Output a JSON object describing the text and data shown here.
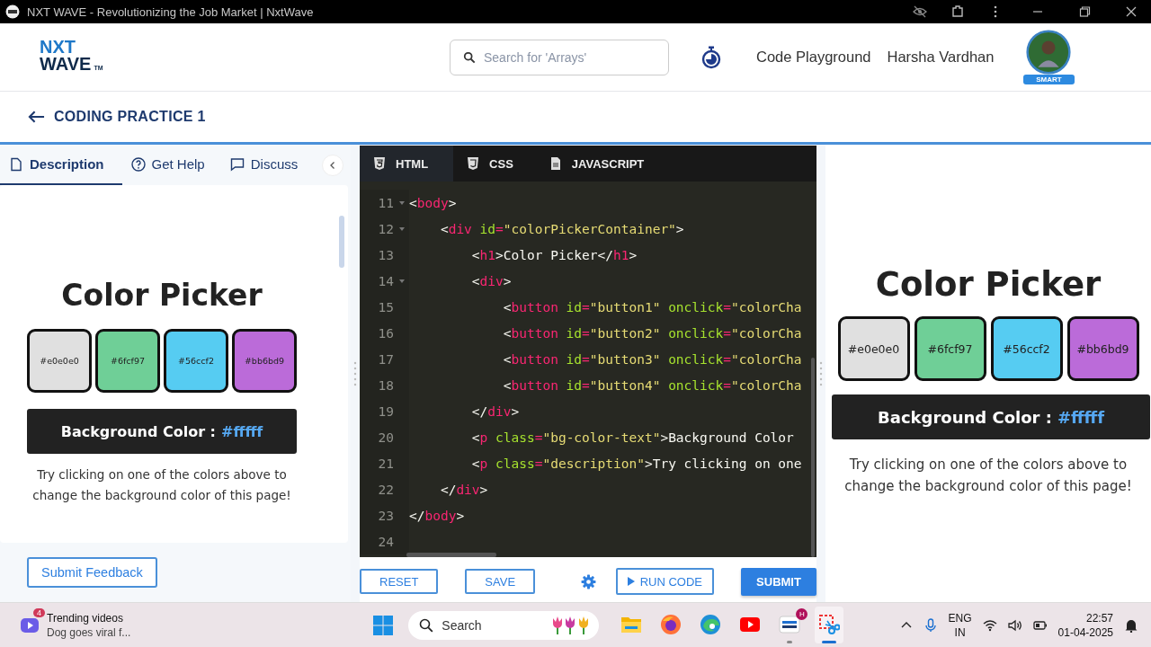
{
  "browser": {
    "title": "NXT WAVE - Revolutionizing the Job Market | NxtWave"
  },
  "header": {
    "logo": {
      "line1": "NXT",
      "line2": "WAVE",
      "mark": "TM"
    },
    "search": {
      "placeholder": "Search for 'Arrays'"
    },
    "link": "Code Playground",
    "user": {
      "name": "Harsha Vardhan",
      "badge": "SMART"
    }
  },
  "practice": {
    "title": "CODING PRACTICE 1"
  },
  "left_tabs": [
    {
      "label": "Description",
      "kind": "file",
      "selected": true
    },
    {
      "label": "Get Help",
      "kind": "help",
      "selected": false
    },
    {
      "label": "Discuss",
      "kind": "chat",
      "selected": false
    }
  ],
  "description_preview": {
    "heading": "Color Picker",
    "swatches": [
      {
        "label": "#e0e0e0",
        "color": "#e0e0e0"
      },
      {
        "label": "#6fcf97",
        "color": "#6fcf97"
      },
      {
        "label": "#56ccf2",
        "color": "#56ccf2"
      },
      {
        "label": "#bb6bd9",
        "color": "#bb6bd9"
      }
    ],
    "bg_label": "Background Color :",
    "bg_value": "#fffff",
    "text": "Try clicking on one of the colors above to change the background color of this page!"
  },
  "feedback_button": "Submit Feedback",
  "editor": {
    "tabs": [
      {
        "label": "HTML",
        "kind": "html",
        "selected": true
      },
      {
        "label": "CSS",
        "kind": "css",
        "selected": false
      },
      {
        "label": "JAVASCRIPT",
        "kind": "js",
        "selected": false
      }
    ],
    "lines": [
      {
        "number": "11",
        "foldable": true,
        "tokens": [
          {
            "kind": "p",
            "text": "<"
          },
          {
            "kind": "tag",
            "text": "body"
          },
          {
            "kind": "p",
            "text": ">"
          }
        ]
      },
      {
        "number": "12",
        "foldable": true,
        "tokens": [
          {
            "kind": "p",
            "text": "    <"
          },
          {
            "kind": "tag",
            "text": "div"
          },
          {
            "kind": "attr",
            "text": " id"
          },
          {
            "kind": "op",
            "text": "="
          },
          {
            "kind": "str",
            "text": "\"colorPickerContainer\""
          },
          {
            "kind": "p",
            "text": ">"
          }
        ]
      },
      {
        "number": "13",
        "foldable": false,
        "tokens": [
          {
            "kind": "p",
            "text": "        <"
          },
          {
            "kind": "tag",
            "text": "h1"
          },
          {
            "kind": "p",
            "text": ">"
          },
          {
            "kind": "txt",
            "text": "Color Picker"
          },
          {
            "kind": "p",
            "text": "</"
          },
          {
            "kind": "tag",
            "text": "h1"
          },
          {
            "kind": "p",
            "text": ">"
          }
        ]
      },
      {
        "number": "14",
        "foldable": true,
        "tokens": [
          {
            "kind": "p",
            "text": "        <"
          },
          {
            "kind": "tag",
            "text": "div"
          },
          {
            "kind": "p",
            "text": ">"
          }
        ]
      },
      {
        "number": "15",
        "foldable": false,
        "tokens": [
          {
            "kind": "p",
            "text": "            <"
          },
          {
            "kind": "tag",
            "text": "button"
          },
          {
            "kind": "attr",
            "text": " id"
          },
          {
            "kind": "op",
            "text": "="
          },
          {
            "kind": "str",
            "text": "\"button1\""
          },
          {
            "kind": "attr",
            "text": " onclick"
          },
          {
            "kind": "op",
            "text": "="
          },
          {
            "kind": "str",
            "text": "\"colorCha"
          }
        ]
      },
      {
        "number": "16",
        "foldable": false,
        "tokens": [
          {
            "kind": "p",
            "text": "            <"
          },
          {
            "kind": "tag",
            "text": "button"
          },
          {
            "kind": "attr",
            "text": " id"
          },
          {
            "kind": "op",
            "text": "="
          },
          {
            "kind": "str",
            "text": "\"button2\""
          },
          {
            "kind": "attr",
            "text": " onclick"
          },
          {
            "kind": "op",
            "text": "="
          },
          {
            "kind": "str",
            "text": "\"colorCha"
          }
        ]
      },
      {
        "number": "17",
        "foldable": false,
        "tokens": [
          {
            "kind": "p",
            "text": "            <"
          },
          {
            "kind": "tag",
            "text": "button"
          },
          {
            "kind": "attr",
            "text": " id"
          },
          {
            "kind": "op",
            "text": "="
          },
          {
            "kind": "str",
            "text": "\"button3\""
          },
          {
            "kind": "attr",
            "text": " onclick"
          },
          {
            "kind": "op",
            "text": "="
          },
          {
            "kind": "str",
            "text": "\"colorCha"
          }
        ]
      },
      {
        "number": "18",
        "foldable": false,
        "tokens": [
          {
            "kind": "p",
            "text": "            <"
          },
          {
            "kind": "tag",
            "text": "button"
          },
          {
            "kind": "attr",
            "text": " id"
          },
          {
            "kind": "op",
            "text": "="
          },
          {
            "kind": "str",
            "text": "\"button4\""
          },
          {
            "kind": "attr",
            "text": " onclick"
          },
          {
            "kind": "op",
            "text": "="
          },
          {
            "kind": "str",
            "text": "\"colorCha"
          }
        ]
      },
      {
        "number": "19",
        "foldable": false,
        "tokens": [
          {
            "kind": "p",
            "text": "        </"
          },
          {
            "kind": "tag",
            "text": "div"
          },
          {
            "kind": "p",
            "text": ">"
          }
        ]
      },
      {
        "number": "20",
        "foldable": false,
        "tokens": [
          {
            "kind": "p",
            "text": "        <"
          },
          {
            "kind": "tag",
            "text": "p"
          },
          {
            "kind": "attr",
            "text": " class"
          },
          {
            "kind": "op",
            "text": "="
          },
          {
            "kind": "str",
            "text": "\"bg-color-text\""
          },
          {
            "kind": "p",
            "text": ">"
          },
          {
            "kind": "txt",
            "text": "Background Color"
          }
        ]
      },
      {
        "number": "21",
        "foldable": false,
        "tokens": [
          {
            "kind": "p",
            "text": "        <"
          },
          {
            "kind": "tag",
            "text": "p"
          },
          {
            "kind": "attr",
            "text": " class"
          },
          {
            "kind": "op",
            "text": "="
          },
          {
            "kind": "str",
            "text": "\"description\""
          },
          {
            "kind": "p",
            "text": ">"
          },
          {
            "kind": "txt",
            "text": "Try clicking on one"
          }
        ]
      },
      {
        "number": "22",
        "foldable": false,
        "tokens": [
          {
            "kind": "p",
            "text": "    </"
          },
          {
            "kind": "tag",
            "text": "div"
          },
          {
            "kind": "p",
            "text": ">"
          }
        ]
      },
      {
        "number": "23",
        "foldable": false,
        "tokens": [
          {
            "kind": "p",
            "text": "</"
          },
          {
            "kind": "tag",
            "text": "body"
          },
          {
            "kind": "p",
            "text": ">"
          }
        ]
      },
      {
        "number": "24",
        "foldable": false
      }
    ],
    "actions": {
      "reset": "RESET",
      "save": "SAVE",
      "run": "RUN CODE",
      "submit": "SUBMIT"
    }
  },
  "output": {
    "heading": "Color Picker",
    "swatches": [
      {
        "label": "#e0e0e0",
        "color": "#e0e0e0"
      },
      {
        "label": "#6fcf97",
        "color": "#6fcf97"
      },
      {
        "label": "#56ccf2",
        "color": "#56ccf2"
      },
      {
        "label": "#bb6bd9",
        "color": "#bb6bd9"
      }
    ],
    "bg_label": "Background Color :",
    "bg_value": "#fffff",
    "text": "Try clicking on one of the colors above to change the background color of this page!"
  },
  "taskbar": {
    "widget": {
      "badge": "4",
      "title": "Trending videos",
      "subtitle": "Dog goes viral f..."
    },
    "search": {
      "placeholder": "Search"
    },
    "apps": [
      {
        "kind": "folder",
        "running": false,
        "selected": false
      },
      {
        "kind": "firefox",
        "running": false,
        "selected": false
      },
      {
        "kind": "edge",
        "running": false,
        "selected": false
      },
      {
        "kind": "youtube",
        "running": false,
        "selected": false
      },
      {
        "kind": "nxtwave",
        "badge": "H",
        "running": true,
        "selected": false
      },
      {
        "kind": "snip",
        "running": true,
        "selected": true
      }
    ],
    "language": "ENG",
    "region": "IN",
    "time": "22:57",
    "date": "01-04-2025"
  }
}
